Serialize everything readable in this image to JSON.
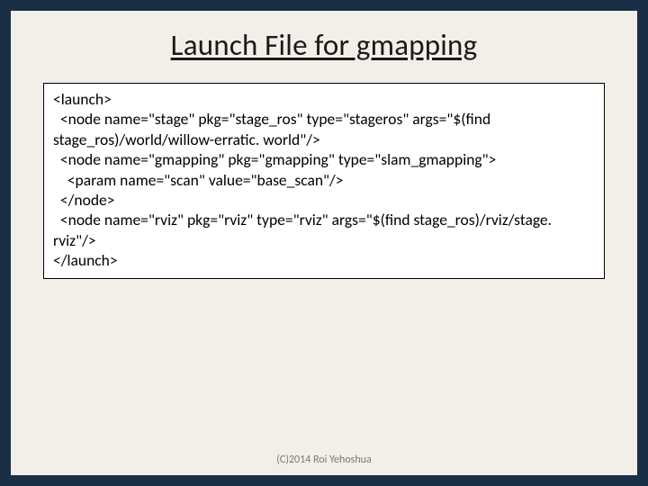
{
  "slide": {
    "title": "Launch File for gmapping",
    "code": "<launch>\n  <node name=\"stage\" pkg=\"stage_ros\" type=\"stageros\" args=\"$(find stage_ros)/world/willow-erratic. world\"/>\n  <node name=\"gmapping\" pkg=\"gmapping\" type=\"slam_gmapping\">\n    <param name=\"scan\" value=\"base_scan\"/>\n  </node>\n  <node name=\"rviz\" pkg=\"rviz\" type=\"rviz\" args=\"$(find stage_ros)/rviz/stage. rviz\"/>\n</launch>",
    "footer": "(C)2014 Roi Yehoshua"
  }
}
